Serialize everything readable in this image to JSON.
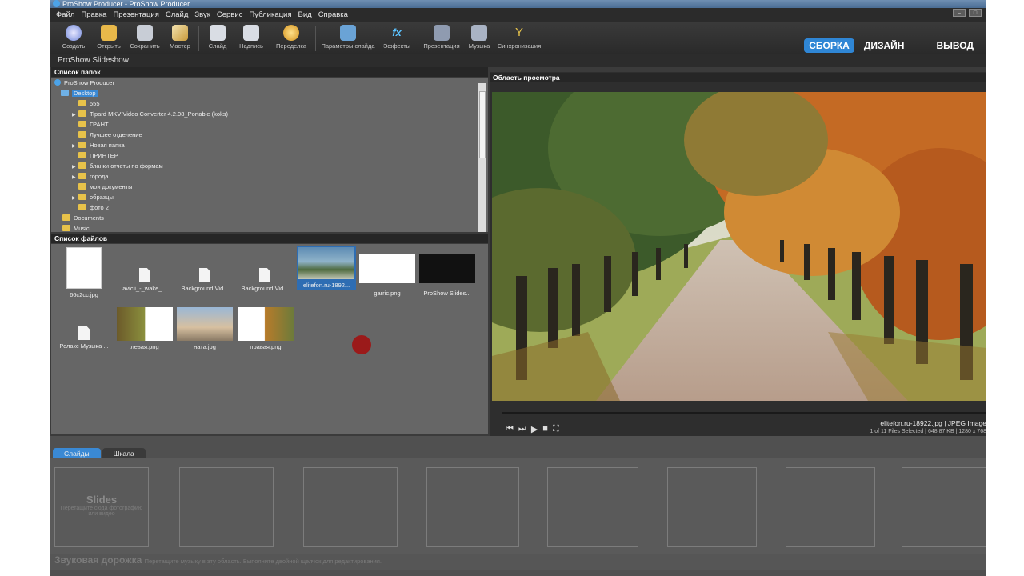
{
  "window": {
    "title": "ProShow Producer - ProShow Producer"
  },
  "menu": [
    "Файл",
    "Правка",
    "Презентация",
    "Слайд",
    "Звук",
    "Сервис",
    "Публикация",
    "Вид",
    "Справка"
  ],
  "toolbar": {
    "create": "Создать",
    "open": "Открыть",
    "save": "Сохранить",
    "wizard": "Мастер",
    "slide": "Слайд",
    "caption": "Надпись",
    "transition": "Переделка",
    "slide_options": "Параметры слайда",
    "effects": "Эффекты",
    "show": "Презентация",
    "music": "Музыка",
    "sync": "Синхронизация"
  },
  "modes": {
    "build": "СБОРКА",
    "design": "ДИЗАЙН",
    "publish": "ВЫВОД"
  },
  "project": {
    "name": "ProShow Slideshow"
  },
  "folders": {
    "header": "Список папок",
    "root": "ProShow Producer",
    "items": [
      "Desktop",
      "555",
      "Tipard MKV Video Converter 4.2.08_Portable (koks)",
      "ГРАНТ",
      "Лучшее отделение",
      "Новая папка",
      "ПРИНТЕР",
      "бланки отчеты по формам",
      "города",
      "мои документы",
      "образцы",
      "фото 2",
      "Documents",
      "Music"
    ]
  },
  "files": {
    "header": "Список файлов",
    "items": [
      "66c2cc.jpg",
      "avicii_-_wake_...",
      "Background Vid...",
      "Background Vid...",
      "elitefon.ru-1892...",
      "garric.png",
      "ProShow Slides...",
      "Релакс Музыка ...",
      "левая.png",
      "ната.jpg",
      "правая.png"
    ]
  },
  "preview": {
    "header": "Область просмотра",
    "file": "elitefon.ru-18922.jpg  |  JPEG Image",
    "details": "1 of 11 Files Selected  |  648.87 KB  |  1280 x 768"
  },
  "bottom": {
    "tab_slides": "Слайды",
    "tab_timeline": "Шкала",
    "slides_title": "Slides",
    "slides_hint": "Перетащите сюда фотографию или видео",
    "audio_title": "Звуковая дорожка",
    "audio_hint": "Перетащите музыку в эту область. Выполните двойной щелчок для редактирования."
  }
}
